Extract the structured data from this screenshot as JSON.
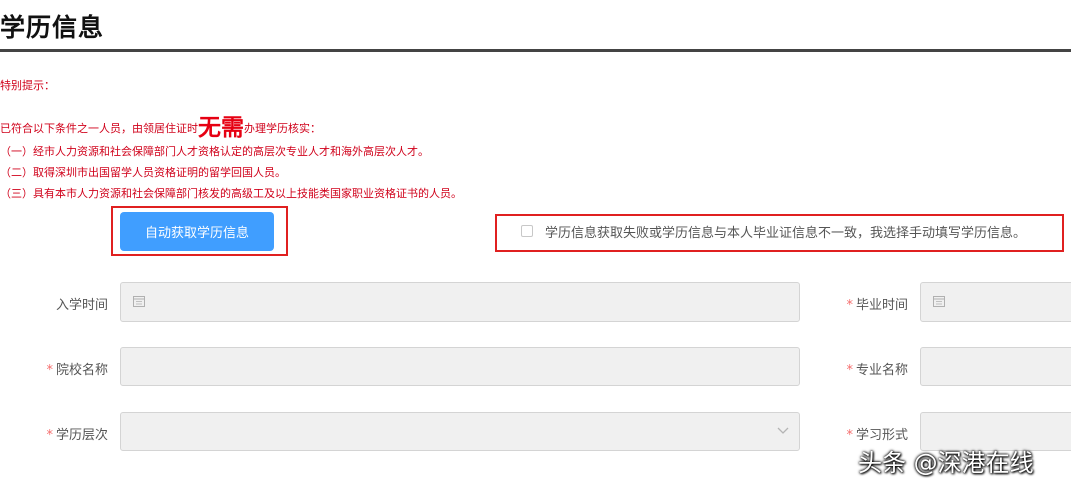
{
  "page_title": "学历信息",
  "notice": {
    "heading": "特别提示：",
    "intro_before": "已符合以下条件之一人员，由领居住证时",
    "intro_emphasis": "无需",
    "intro_after": "办理学历核实：",
    "items": [
      "（一）经市人力资源和社会保障部门人才资格认定的高层次专业人才和海外高层次人才。",
      "（二）取得深圳市出国留学人员资格证明的留学回国人员。",
      "（三）具有本市人力资源和社会保障部门核发的高级工及以上技能类国家职业资格证书的人员。"
    ]
  },
  "auto_button_label": "自动获取学历信息",
  "manual_option_label": "学历信息获取失败或学历信息与本人毕业证信息不一致，我选择手动填写学历信息。",
  "manual_option_checked": false,
  "form": {
    "required_mark": "*",
    "enroll_time": {
      "label": "入学时间",
      "value": "",
      "required": false,
      "icon": "calendar-icon"
    },
    "graduate_time": {
      "label": "毕业时间",
      "value": "",
      "required": true,
      "icon": "calendar-icon"
    },
    "school_name": {
      "label": "院校名称",
      "value": "",
      "required": true
    },
    "major_name": {
      "label": "专业名称",
      "value": "",
      "required": true
    },
    "edu_level": {
      "label": "学历层次",
      "value": "",
      "required": true,
      "icon": "chevron-down-icon"
    },
    "study_form": {
      "label": "学习形式",
      "value": "",
      "required": true
    }
  },
  "watermark": "头条 @深港在线",
  "colors": {
    "notice_red": "#d0021b",
    "button_blue": "#409eff",
    "highlight_box": "#e02020",
    "required_star": "#f56c6c",
    "field_bg": "#f0f0f0"
  }
}
